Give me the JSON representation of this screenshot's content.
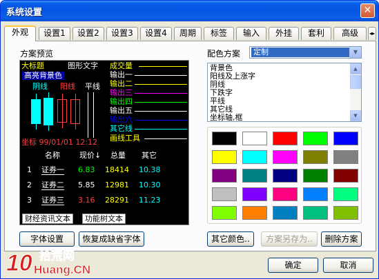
{
  "window": {
    "title": "系统设置",
    "close_glyph": "✕"
  },
  "tabs": [
    "外观",
    "设置1",
    "设置2",
    "设置3",
    "设置4",
    "周期",
    "标签",
    "输入",
    "外挂",
    "套利",
    "高级"
  ],
  "preview": {
    "section_label": "方案预览",
    "title_text": "大标题",
    "graph_text": "图形文字",
    "volume_label": "成交量",
    "highlight_bg": "高亮背景色",
    "yin_line": "阴线",
    "yang_line": "阳线",
    "flat_line": "平线",
    "outputs": [
      "输出一",
      "输出二",
      "输出三",
      "输出四",
      "输出五",
      "输出六"
    ],
    "other_line": "其它线",
    "drawing_tool": "画线工具",
    "coordinate": "坐标 99/01/01 12:12",
    "table_headers": [
      "名称",
      "现价↓",
      "总量",
      "其它"
    ],
    "rows": [
      {
        "idx": "1",
        "name": "证券一",
        "price": "6.83",
        "volume": "18414",
        "other": "10.38"
      },
      {
        "idx": "2",
        "name": "证券二",
        "price": "5.85",
        "volume": "12981",
        "other": "10.30"
      },
      {
        "idx": "3",
        "name": "证券三",
        "price": "3.16",
        "volume": "28291",
        "other": "11.23"
      }
    ],
    "news_text": "财经资讯文本",
    "func_tree_text": "功能树文本"
  },
  "buttons": {
    "font_settings": "字体设置",
    "restore_default_font": "恢复成缺省字体",
    "other_colors": "其它颜色..",
    "save_scheme_as": "方案另存为..",
    "delete_scheme": "删除方案",
    "ok": "确定",
    "cancel": "取消"
  },
  "color_scheme": {
    "label": "配色方案",
    "selected": "定制",
    "elements": [
      "背景色",
      "阳线及上涨字",
      "阴线",
      "下跌字",
      "平线",
      "其它线",
      "坐标轴,框"
    ]
  },
  "palette": [
    "#000000",
    "#ffffff",
    "#ff0000",
    "#00ff00",
    "#0000ff",
    "#ffff00",
    "#00ffff",
    "#ff00ff",
    "#808000",
    "#808080",
    "#800080",
    "#008080",
    "#000080",
    "#008000",
    "#800000",
    "#c0c0c0",
    "#8000ff",
    "#ff0080",
    "#0080ff",
    "#00ff80",
    "#80ff00",
    "#ff8000",
    "#0080c0",
    "#00c080",
    "#80c000"
  ],
  "watermark": {
    "brand_digits": "10",
    "brand_cn": "拾荒网",
    "brand_url": "Huang.CN"
  },
  "colors": {
    "yellow": "#ffff00",
    "white": "#ffffff",
    "red": "#ff4040",
    "cyan": "#00ffff",
    "green": "#00ff00",
    "magenta": "#ff00ff",
    "blue": "#0000ff",
    "highlight": "#0000a0"
  }
}
